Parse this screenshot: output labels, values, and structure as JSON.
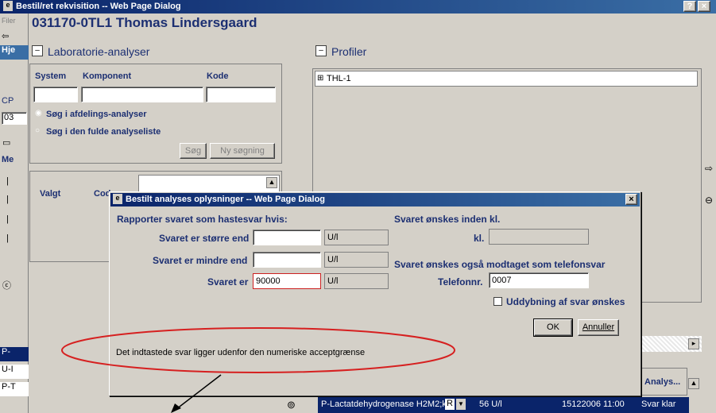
{
  "outer_window": {
    "title": "Bestil/ret rekvisition -- Web Page Dialog",
    "help": "?",
    "close": "×",
    "patient": "031170-0TL1 Thomas Lindersgaard"
  },
  "lab": {
    "header": "Laboratorie-analyser",
    "col_system": "System",
    "col_komponent": "Komponent",
    "col_kode": "Kode",
    "radio1": "Søg i afdelings-analyser",
    "radio2": "Søg i den fulde analyseliste",
    "btn_search": "Søg",
    "btn_new_search": "Ny søgning",
    "list_col1": "Valgt",
    "list_col2": "Cod"
  },
  "profiles": {
    "header": "Profiler",
    "items": [
      "THL-1"
    ]
  },
  "left_edge": {
    "fil": "Filer",
    "hje": "Hje",
    "cp": "CP",
    "val03": "03",
    "me": "Me",
    "rows": [
      "P-",
      "U-I",
      "P-T"
    ],
    "radio": "ⓒ"
  },
  "dialog": {
    "title": "Bestilt analyses oplysninger -- Web Page Dialog",
    "close": "×",
    "section1": "Rapporter svaret som hastesvar hvis:",
    "greater_label": "Svaret er større end",
    "greater_value": "",
    "greater_unit": "U/l",
    "less_label": "Svaret er mindre end",
    "less_value": "",
    "less_unit": "U/l",
    "is_label": "Svaret er",
    "is_value": "90000",
    "is_unit": "U/l",
    "section2": "Svaret ønskes inden kl.",
    "kl_label": "kl.",
    "kl_value": "",
    "section3": "Svaret ønskes også modtaget som telefonsvar",
    "phone_label": "Telefonnr.",
    "phone_value": "0007",
    "uddybning": "Uddybning af svar ønskes",
    "ok": "OK",
    "cancel": "Annuller",
    "message": "Det indtastede svar ligger udenfor den numeriske acceptgrænse"
  },
  "bottom": {
    "col_analys": "Analys...",
    "row_name": "P-Lactatdehydrogenase H2M2;ka",
    "row_flag": "R",
    "row_value": "56 U/l",
    "row_time": "15122006 11:00",
    "row_status": "Svar klar"
  },
  "colors": {
    "label_blue": "#1c2f72",
    "title_blue": "#0a246a",
    "annotation_red": "#d62020",
    "error_field_border": "#cc2020"
  }
}
